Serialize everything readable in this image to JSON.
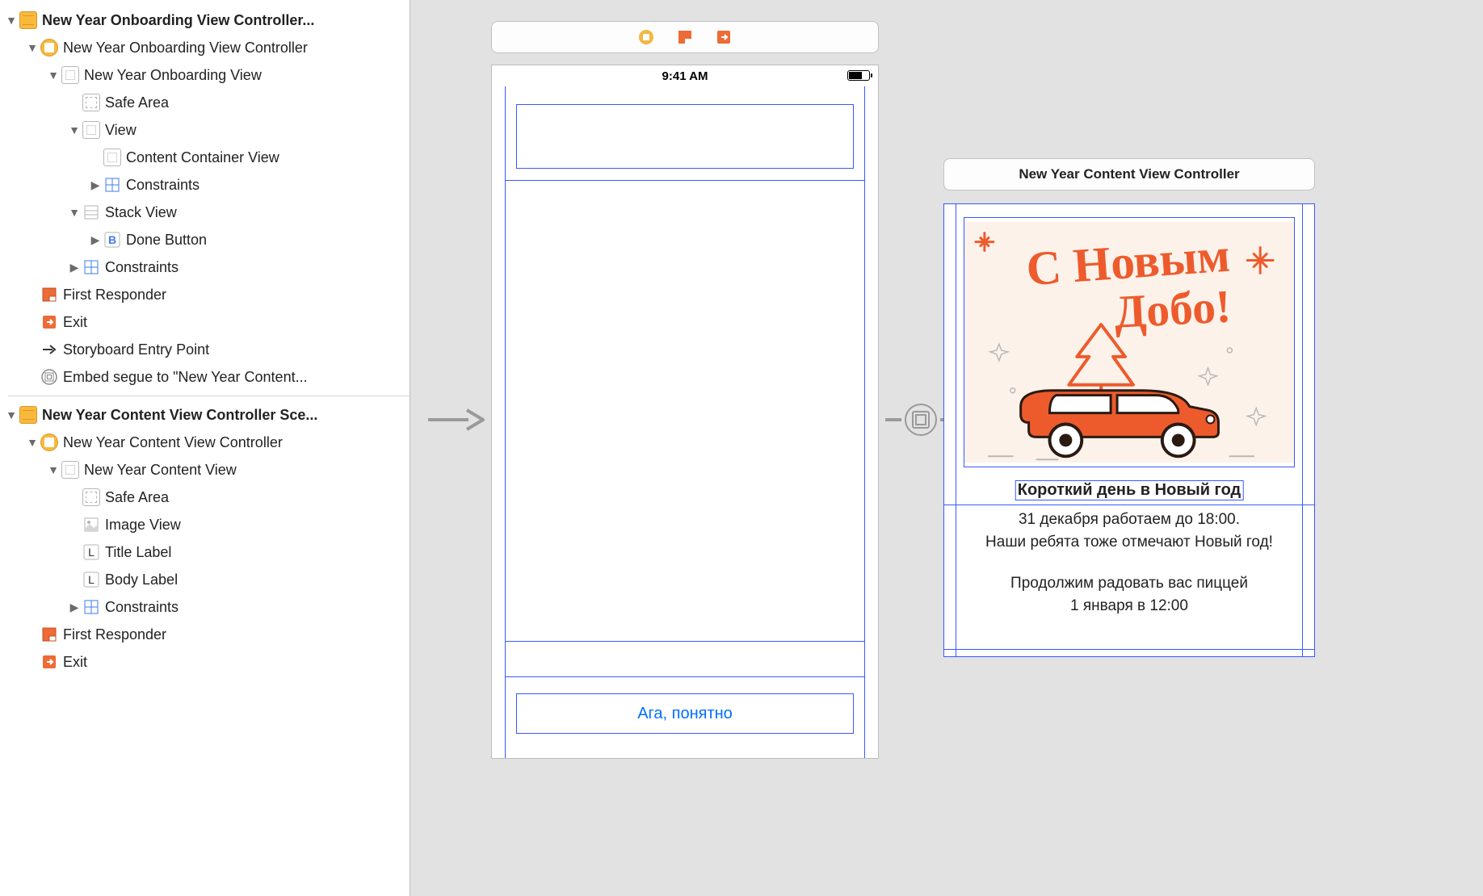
{
  "outline": {
    "scene1_header": "New Year Onboarding View Controller...",
    "scene1_vc": "New Year Onboarding View Controller",
    "scene1_rootview": "New Year Onboarding View",
    "safe_area": "Safe Area",
    "view": "View",
    "content_container": "Content Container View",
    "constraints": "Constraints",
    "stack_view": "Stack View",
    "done_button": "Done Button",
    "first_responder": "First Responder",
    "exit": "Exit",
    "entry_point": "Storyboard Entry Point",
    "embed_segue": "Embed segue to \"New Year Content...",
    "scene2_header": "New Year Content View Controller Sce...",
    "scene2_vc": "New Year Content View Controller",
    "scene2_rootview": "New Year Content View",
    "image_view": "Image View",
    "title_label": "Title Label",
    "body_label": "Body Label"
  },
  "canvas": {
    "status_time": "9:41 AM",
    "done_label": "Ага, понятно",
    "content_scene_title": "New Year Content View Controller",
    "title_label_text": "Короткий день в Новый год",
    "body_line1": "31 декабря работаем до 18:00.",
    "body_line2": "Наши ребята тоже отмечают Новый год!",
    "body_line3": "Продолжим радовать вас пиццей",
    "body_line4": "1 января в 12:00"
  },
  "colors": {
    "ib_blue": "#3a57ff",
    "accent_orange": "#ed5b2d",
    "toolbar_yellow": "#f4b63f"
  }
}
